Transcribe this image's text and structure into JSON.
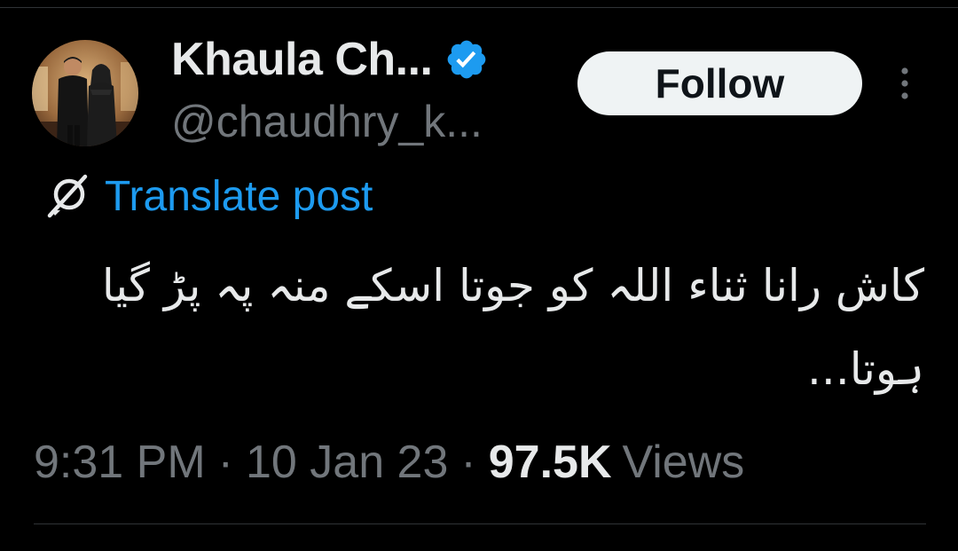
{
  "author": {
    "display_name": "Khaula Ch...",
    "handle": "@chaudhry_k...",
    "verified": true
  },
  "actions": {
    "follow_label": "Follow",
    "more_icon": "more-vertical-icon"
  },
  "translate": {
    "label": "Translate post",
    "icon": "translate-globe-icon"
  },
  "post": {
    "text": "کاش رانا ثناء اللہ کو جوتا اسکے منہ پہ پڑ گیا ہوتا..."
  },
  "meta": {
    "time": "9:31 PM",
    "separator": "·",
    "date": "10 Jan 23",
    "views_count": "97.5K",
    "views_label": "Views"
  },
  "colors": {
    "background": "#000000",
    "primary_text": "#e7e9ea",
    "secondary_text": "#71767b",
    "link": "#1d9bf0",
    "verified_badge": "#1d9bf0",
    "follow_button_bg": "#eff3f4",
    "follow_button_text": "#0f1419",
    "divider": "#2f3336"
  }
}
